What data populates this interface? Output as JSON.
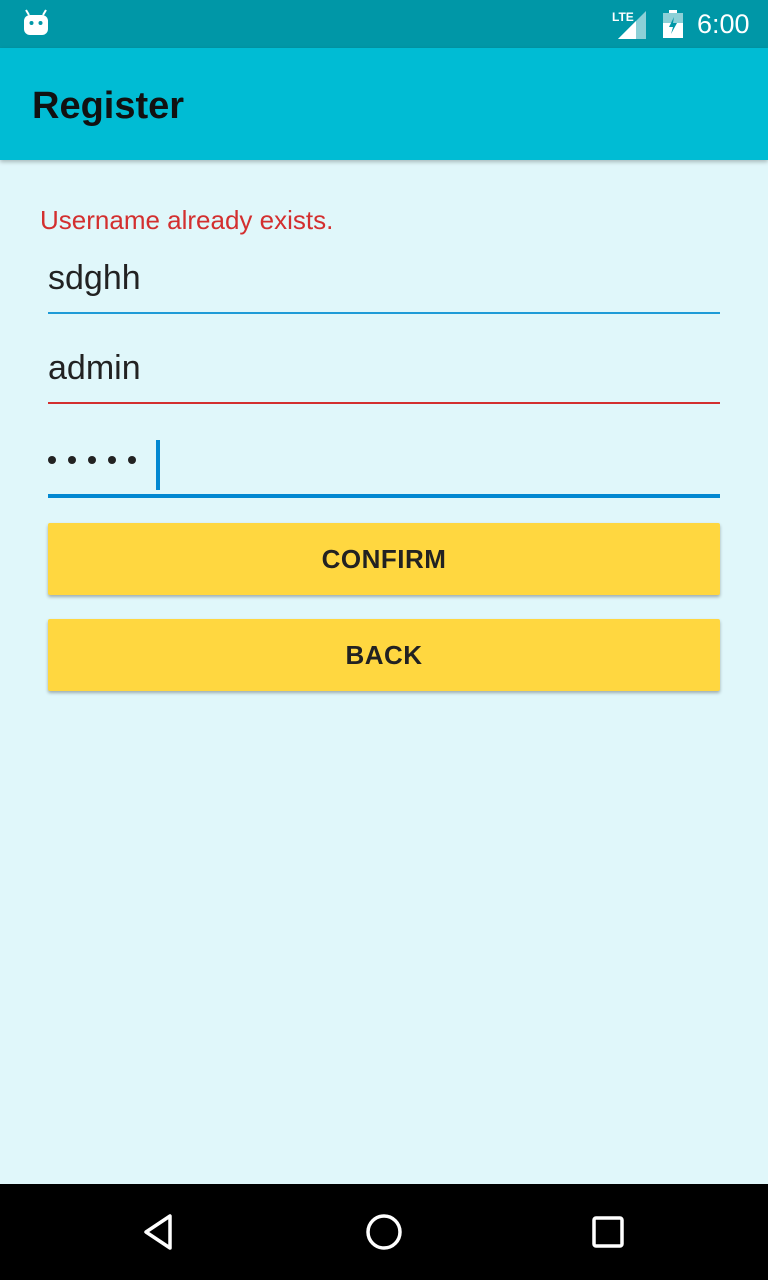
{
  "status_bar": {
    "time": "6:00",
    "network_label": "LTE",
    "icons": [
      "android-icon",
      "lte-signal-icon",
      "battery-icon"
    ]
  },
  "app_bar": {
    "title": "Register"
  },
  "form": {
    "error_message": "Username already exists.",
    "username_value": "sdghh",
    "email_value": "admin",
    "password_mask_count": 5,
    "error_color": "#d32f2f",
    "accent_color": "#0288d1"
  },
  "buttons": {
    "confirm_label": "CONFIRM",
    "back_label": "BACK",
    "color": "#ffd740"
  },
  "nav_bar": {
    "icons": [
      "back-triangle-icon",
      "home-circle-icon",
      "recent-square-icon"
    ]
  },
  "theme": {
    "background": "#e0f7fa",
    "app_bar_color": "#00bcd4",
    "status_bar_color": "#0097a7"
  }
}
